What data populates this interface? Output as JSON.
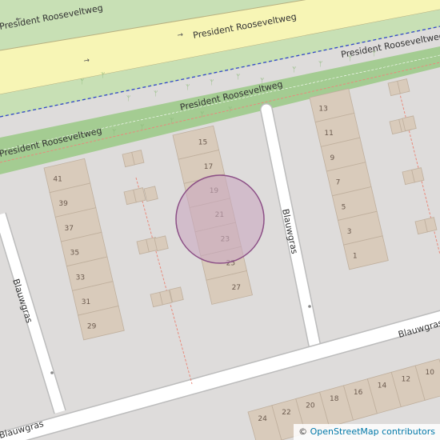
{
  "map": {
    "colors": {
      "background": "#dedcdb",
      "park": "#c8e0b5",
      "motorway_fill": "#f7f5b5",
      "grass_strip": "#a4cc92",
      "service_road": "#ffffff",
      "building": "#d9cbbb",
      "building_outline": "#bfaf9d",
      "marker_fill": "#c9a8c0",
      "marker_stroke": "#8c4f86",
      "footpath": "#e88a7c",
      "boundary": "#3344cc"
    },
    "streets": {
      "president_1": "President Rooseveltweg",
      "president_2": "President Rooseveltweg",
      "president_3": "President Rooseveltweg",
      "president_4": "President Rooseveltweg",
      "president_5": "President Rooseveltweg",
      "blauwgras_east": "Blauwgras",
      "blauwgras_west": "Blauwgras",
      "blauwgras_south_main": "Blauwgras",
      "blauwgras_south_left": "Blauwgras"
    },
    "house_numbers": {
      "middle": [
        "15",
        "17",
        "19",
        "21",
        "23",
        "25",
        "27"
      ],
      "left": [
        "41",
        "39",
        "37",
        "35",
        "33",
        "31",
        "29"
      ],
      "right": [
        "13",
        "11",
        "9",
        "7",
        "5",
        "3",
        "1"
      ],
      "bottom": [
        "24",
        "22",
        "20",
        "18",
        "16",
        "14",
        "12",
        "10"
      ]
    },
    "marker": {
      "label": "location-circle"
    }
  },
  "attribution": {
    "copyright": "©",
    "link_text": "OpenStreetMap contributors"
  }
}
